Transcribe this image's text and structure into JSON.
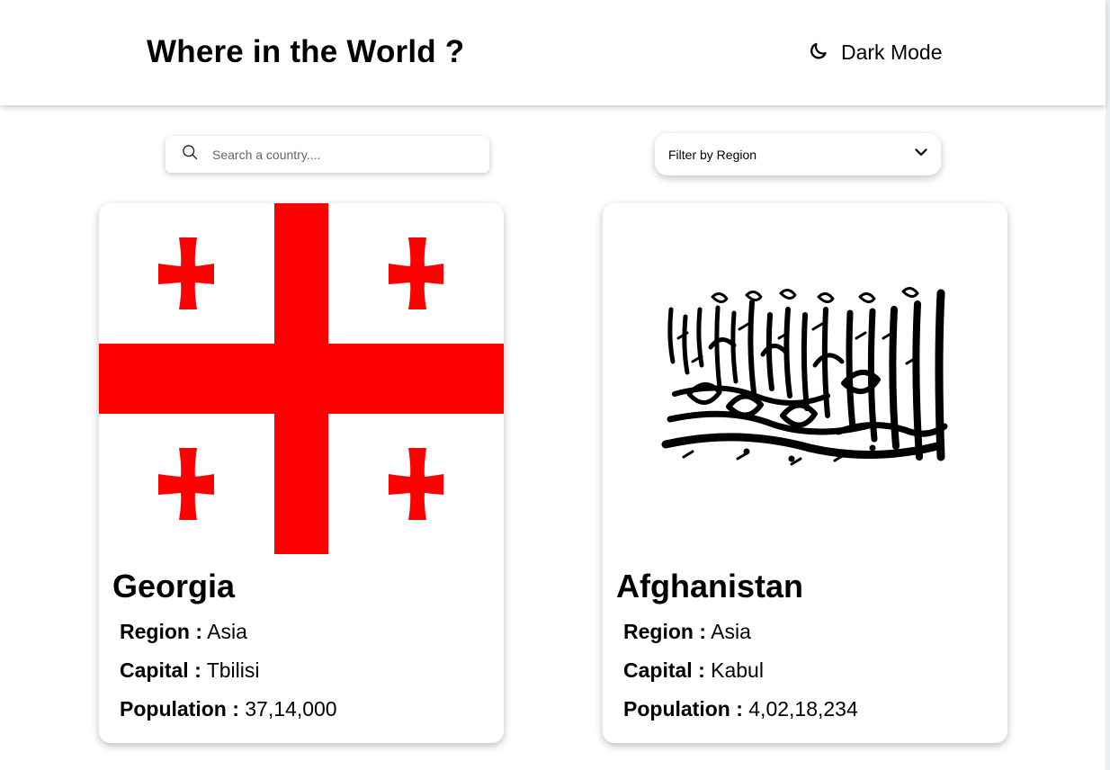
{
  "header": {
    "title": "Where in the World ?",
    "dark_mode_label": "Dark Mode",
    "dark_mode_icon": "moon-icon"
  },
  "search": {
    "placeholder": "Search a country....",
    "value": "",
    "icon": "search-icon"
  },
  "filter": {
    "label": "Filter by Region",
    "icon": "chevron-down-icon"
  },
  "countries": [
    {
      "name": "Georgia",
      "region_label": "Region :",
      "region": "Asia",
      "capital_label": "Capital :",
      "capital": "Tbilisi",
      "population_label": "Population :",
      "population": "37,14,000",
      "flag": "georgia-flag",
      "flag_color": "#ff0000"
    },
    {
      "name": "Afghanistan",
      "region_label": "Region :",
      "region": "Asia",
      "capital_label": "Capital :",
      "capital": "Kabul",
      "population_label": "Population :",
      "population": "4,02,18,234",
      "flag": "afghanistan-flag"
    }
  ]
}
